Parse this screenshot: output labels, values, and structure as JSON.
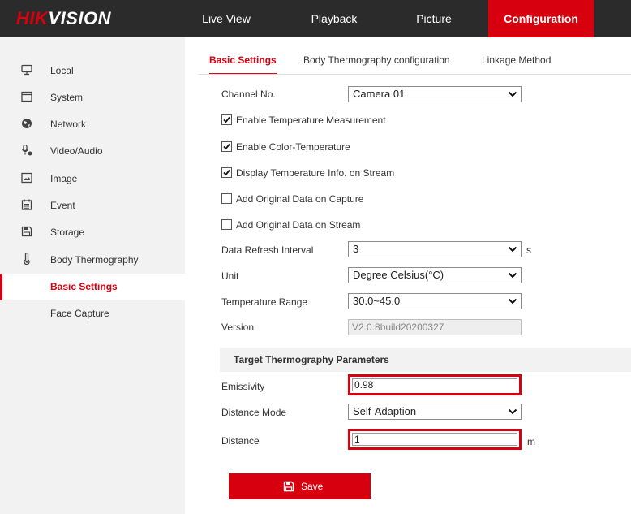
{
  "brand": {
    "logo_accent": "HIK",
    "logo_rest": "VISION",
    "accent_color": "#d7000f"
  },
  "nav": {
    "live_view": "Live View",
    "playback": "Playback",
    "picture": "Picture",
    "configuration": "Configuration"
  },
  "sidebar": {
    "items": [
      {
        "label": "Local",
        "icon": "monitor-icon"
      },
      {
        "label": "System",
        "icon": "system-window-icon"
      },
      {
        "label": "Network",
        "icon": "globe-icon"
      },
      {
        "label": "Video/Audio",
        "icon": "microphone-icon"
      },
      {
        "label": "Image",
        "icon": "image-icon"
      },
      {
        "label": "Event",
        "icon": "calendar-icon"
      },
      {
        "label": "Storage",
        "icon": "floppy-disk-icon"
      },
      {
        "label": "Body Thermography",
        "icon": "thermometer-icon"
      }
    ],
    "sub_items": [
      {
        "label": "Basic Settings",
        "active": true
      },
      {
        "label": "Face Capture",
        "active": false
      }
    ]
  },
  "tabs": {
    "basic": "Basic Settings",
    "body": "Body Thermography configuration",
    "linkage": "Linkage Method"
  },
  "form": {
    "channel_label": "Channel No.",
    "channel_value": "Camera 01",
    "checks": [
      {
        "label": "Enable Temperature Measurement",
        "checked": true
      },
      {
        "label": "Enable Color-Temperature",
        "checked": true
      },
      {
        "label": "Display Temperature Info. on Stream",
        "checked": true
      },
      {
        "label": "Add Original Data on Capture",
        "checked": false
      },
      {
        "label": "Add Original Data on Stream",
        "checked": false
      }
    ],
    "refresh_label": "Data Refresh Interval",
    "refresh_value": "3",
    "refresh_unit": "s",
    "unit_label": "Unit",
    "unit_value": "Degree Celsius(°C)",
    "range_label": "Temperature Range",
    "range_value": "30.0~45.0",
    "version_label": "Version",
    "version_value": "V2.0.8build20200327"
  },
  "target": {
    "title": "Target Thermography Parameters",
    "emissivity_label": "Emissivity",
    "emissivity_value": "0.98",
    "distance_mode_label": "Distance Mode",
    "distance_mode_value": "Self-Adaption",
    "distance_label": "Distance",
    "distance_value": "1",
    "distance_unit": "m"
  },
  "save": {
    "label": "Save",
    "icon": "floppy-disk-icon"
  }
}
